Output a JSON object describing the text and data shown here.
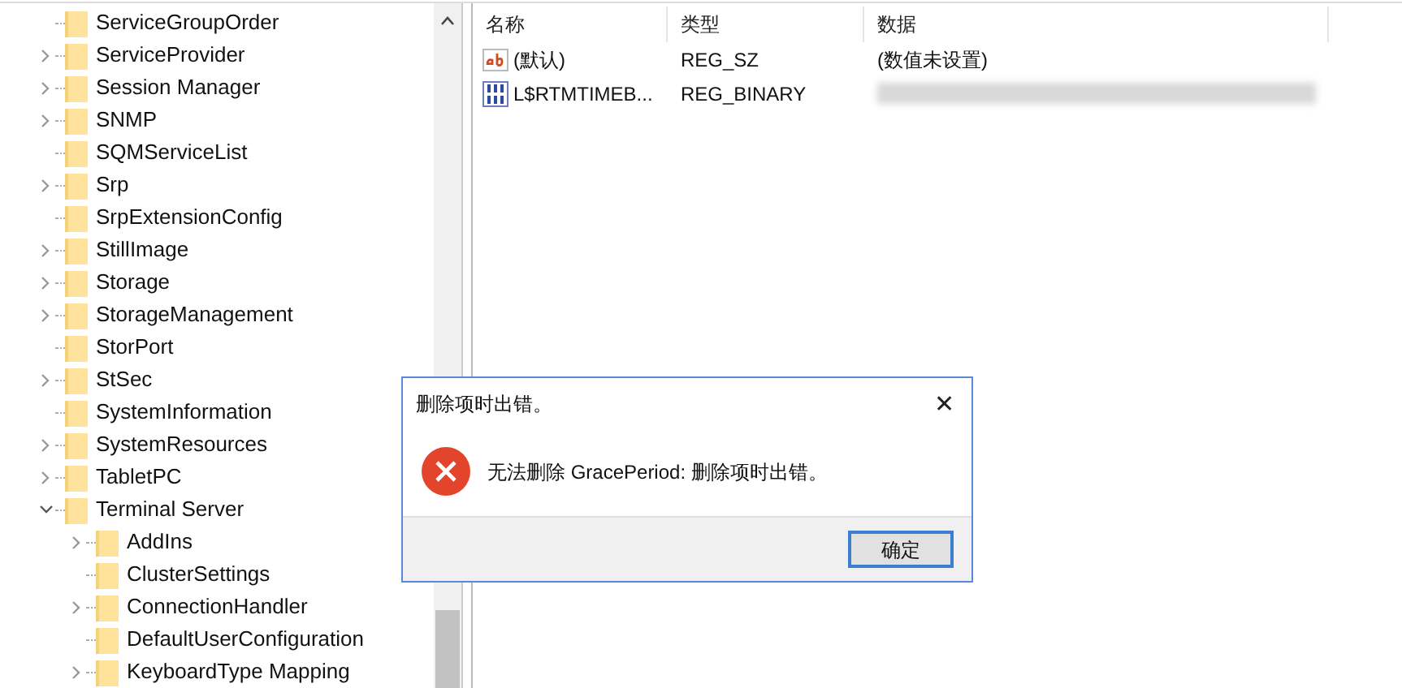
{
  "tree": [
    {
      "label": "ServiceGroupOrder",
      "expandable": false
    },
    {
      "label": "ServiceProvider",
      "expandable": true,
      "expanded": false
    },
    {
      "label": "Session Manager",
      "expandable": true,
      "expanded": false
    },
    {
      "label": "SNMP",
      "expandable": true,
      "expanded": false
    },
    {
      "label": "SQMServiceList",
      "expandable": false
    },
    {
      "label": "Srp",
      "expandable": true,
      "expanded": false
    },
    {
      "label": "SrpExtensionConfig",
      "expandable": false
    },
    {
      "label": "StillImage",
      "expandable": true,
      "expanded": false
    },
    {
      "label": "Storage",
      "expandable": true,
      "expanded": false
    },
    {
      "label": "StorageManagement",
      "expandable": true,
      "expanded": false
    },
    {
      "label": "StorPort",
      "expandable": false
    },
    {
      "label": "StSec",
      "expandable": true,
      "expanded": false
    },
    {
      "label": "SystemInformation",
      "expandable": false
    },
    {
      "label": "SystemResources",
      "expandable": true,
      "expanded": false
    },
    {
      "label": "TabletPC",
      "expandable": true,
      "expanded": false
    },
    {
      "label": "Terminal Server",
      "expandable": true,
      "expanded": true,
      "children": [
        {
          "label": "AddIns",
          "expandable": true,
          "expanded": false
        },
        {
          "label": "ClusterSettings",
          "expandable": false
        },
        {
          "label": "ConnectionHandler",
          "expandable": true,
          "expanded": false
        },
        {
          "label": "DefaultUserConfiguration",
          "expandable": false
        },
        {
          "label": "KeyboardType Mapping",
          "expandable": true,
          "expanded": false
        }
      ]
    }
  ],
  "table": {
    "columns": [
      "名称",
      "类型",
      "数据"
    ],
    "rows": [
      {
        "kind": "string",
        "name": "(默认)",
        "type": "REG_SZ",
        "data": "(数值未设置)"
      },
      {
        "kind": "binary",
        "name": "L$RTMTIMEB...",
        "type": "REG_BINARY",
        "data_blurred": true
      }
    ]
  },
  "dialog": {
    "title": "删除项时出错。",
    "close": "✕",
    "message": "无法删除 GracePeriod: 删除项时出错。",
    "button": "确定"
  }
}
